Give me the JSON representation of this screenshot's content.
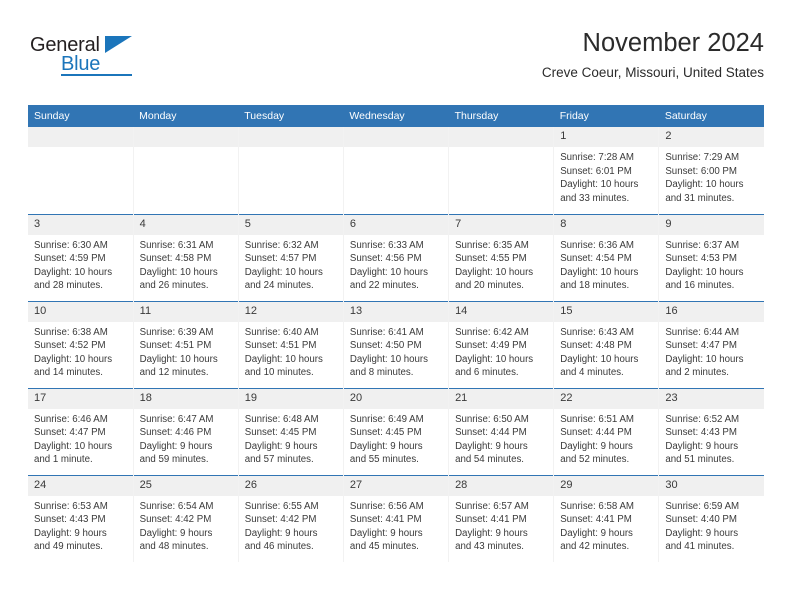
{
  "logo": {
    "text_top": "General",
    "text_bottom": "Blue",
    "triangle_color": "#1b75bb",
    "top_color": "#231f20",
    "bottom_color": "#1b75bb"
  },
  "header": {
    "title": "November 2024",
    "location": "Creve Coeur, Missouri, United States"
  },
  "theme": {
    "header_blue": "#3175b4",
    "daynum_band": "#f0f0f0",
    "text": "#3a3a3a"
  },
  "columns": [
    "Sunday",
    "Monday",
    "Tuesday",
    "Wednesday",
    "Thursday",
    "Friday",
    "Saturday"
  ],
  "weeks": [
    [
      {
        "day": "",
        "lines": []
      },
      {
        "day": "",
        "lines": []
      },
      {
        "day": "",
        "lines": []
      },
      {
        "day": "",
        "lines": []
      },
      {
        "day": "",
        "lines": []
      },
      {
        "day": "1",
        "lines": [
          "Sunrise: 7:28 AM",
          "Sunset: 6:01 PM",
          "Daylight: 10 hours",
          "and 33 minutes."
        ]
      },
      {
        "day": "2",
        "lines": [
          "Sunrise: 7:29 AM",
          "Sunset: 6:00 PM",
          "Daylight: 10 hours",
          "and 31 minutes."
        ]
      }
    ],
    [
      {
        "day": "3",
        "lines": [
          "Sunrise: 6:30 AM",
          "Sunset: 4:59 PM",
          "Daylight: 10 hours",
          "and 28 minutes."
        ]
      },
      {
        "day": "4",
        "lines": [
          "Sunrise: 6:31 AM",
          "Sunset: 4:58 PM",
          "Daylight: 10 hours",
          "and 26 minutes."
        ]
      },
      {
        "day": "5",
        "lines": [
          "Sunrise: 6:32 AM",
          "Sunset: 4:57 PM",
          "Daylight: 10 hours",
          "and 24 minutes."
        ]
      },
      {
        "day": "6",
        "lines": [
          "Sunrise: 6:33 AM",
          "Sunset: 4:56 PM",
          "Daylight: 10 hours",
          "and 22 minutes."
        ]
      },
      {
        "day": "7",
        "lines": [
          "Sunrise: 6:35 AM",
          "Sunset: 4:55 PM",
          "Daylight: 10 hours",
          "and 20 minutes."
        ]
      },
      {
        "day": "8",
        "lines": [
          "Sunrise: 6:36 AM",
          "Sunset: 4:54 PM",
          "Daylight: 10 hours",
          "and 18 minutes."
        ]
      },
      {
        "day": "9",
        "lines": [
          "Sunrise: 6:37 AM",
          "Sunset: 4:53 PM",
          "Daylight: 10 hours",
          "and 16 minutes."
        ]
      }
    ],
    [
      {
        "day": "10",
        "lines": [
          "Sunrise: 6:38 AM",
          "Sunset: 4:52 PM",
          "Daylight: 10 hours",
          "and 14 minutes."
        ]
      },
      {
        "day": "11",
        "lines": [
          "Sunrise: 6:39 AM",
          "Sunset: 4:51 PM",
          "Daylight: 10 hours",
          "and 12 minutes."
        ]
      },
      {
        "day": "12",
        "lines": [
          "Sunrise: 6:40 AM",
          "Sunset: 4:51 PM",
          "Daylight: 10 hours",
          "and 10 minutes."
        ]
      },
      {
        "day": "13",
        "lines": [
          "Sunrise: 6:41 AM",
          "Sunset: 4:50 PM",
          "Daylight: 10 hours",
          "and 8 minutes."
        ]
      },
      {
        "day": "14",
        "lines": [
          "Sunrise: 6:42 AM",
          "Sunset: 4:49 PM",
          "Daylight: 10 hours",
          "and 6 minutes."
        ]
      },
      {
        "day": "15",
        "lines": [
          "Sunrise: 6:43 AM",
          "Sunset: 4:48 PM",
          "Daylight: 10 hours",
          "and 4 minutes."
        ]
      },
      {
        "day": "16",
        "lines": [
          "Sunrise: 6:44 AM",
          "Sunset: 4:47 PM",
          "Daylight: 10 hours",
          "and 2 minutes."
        ]
      }
    ],
    [
      {
        "day": "17",
        "lines": [
          "Sunrise: 6:46 AM",
          "Sunset: 4:47 PM",
          "Daylight: 10 hours",
          "and 1 minute."
        ]
      },
      {
        "day": "18",
        "lines": [
          "Sunrise: 6:47 AM",
          "Sunset: 4:46 PM",
          "Daylight: 9 hours",
          "and 59 minutes."
        ]
      },
      {
        "day": "19",
        "lines": [
          "Sunrise: 6:48 AM",
          "Sunset: 4:45 PM",
          "Daylight: 9 hours",
          "and 57 minutes."
        ]
      },
      {
        "day": "20",
        "lines": [
          "Sunrise: 6:49 AM",
          "Sunset: 4:45 PM",
          "Daylight: 9 hours",
          "and 55 minutes."
        ]
      },
      {
        "day": "21",
        "lines": [
          "Sunrise: 6:50 AM",
          "Sunset: 4:44 PM",
          "Daylight: 9 hours",
          "and 54 minutes."
        ]
      },
      {
        "day": "22",
        "lines": [
          "Sunrise: 6:51 AM",
          "Sunset: 4:44 PM",
          "Daylight: 9 hours",
          "and 52 minutes."
        ]
      },
      {
        "day": "23",
        "lines": [
          "Sunrise: 6:52 AM",
          "Sunset: 4:43 PM",
          "Daylight: 9 hours",
          "and 51 minutes."
        ]
      }
    ],
    [
      {
        "day": "24",
        "lines": [
          "Sunrise: 6:53 AM",
          "Sunset: 4:43 PM",
          "Daylight: 9 hours",
          "and 49 minutes."
        ]
      },
      {
        "day": "25",
        "lines": [
          "Sunrise: 6:54 AM",
          "Sunset: 4:42 PM",
          "Daylight: 9 hours",
          "and 48 minutes."
        ]
      },
      {
        "day": "26",
        "lines": [
          "Sunrise: 6:55 AM",
          "Sunset: 4:42 PM",
          "Daylight: 9 hours",
          "and 46 minutes."
        ]
      },
      {
        "day": "27",
        "lines": [
          "Sunrise: 6:56 AM",
          "Sunset: 4:41 PM",
          "Daylight: 9 hours",
          "and 45 minutes."
        ]
      },
      {
        "day": "28",
        "lines": [
          "Sunrise: 6:57 AM",
          "Sunset: 4:41 PM",
          "Daylight: 9 hours",
          "and 43 minutes."
        ]
      },
      {
        "day": "29",
        "lines": [
          "Sunrise: 6:58 AM",
          "Sunset: 4:41 PM",
          "Daylight: 9 hours",
          "and 42 minutes."
        ]
      },
      {
        "day": "30",
        "lines": [
          "Sunrise: 6:59 AM",
          "Sunset: 4:40 PM",
          "Daylight: 9 hours",
          "and 41 minutes."
        ]
      }
    ]
  ]
}
